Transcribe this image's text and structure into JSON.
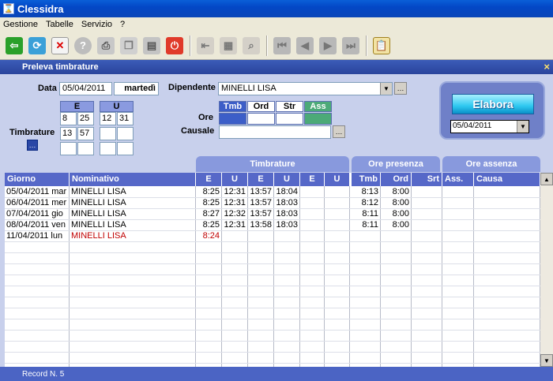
{
  "window": {
    "title": "Clessidra"
  },
  "menu": [
    "Gestione",
    "Tabelle",
    "Servizio",
    "?"
  ],
  "toolbar": {
    "buttons": [
      "exit",
      "refresh",
      "delete",
      "help",
      "print",
      "copy",
      "save",
      "power",
      "first-disabled",
      "calc",
      "zoom",
      "nav-first",
      "nav-prev",
      "nav-next",
      "nav-last",
      "clipboard"
    ]
  },
  "panel": {
    "title": "Preleva timbrature",
    "close": "×",
    "data_label": "Data",
    "data_value": "05/04/2011",
    "weekday": "martedì",
    "dipendente_label": "Dipendente",
    "dipendente_value": "MINELLI LISA",
    "timbrature_label": "Timbrature",
    "e_header": "E",
    "u_header": "U",
    "e_cells": [
      [
        "8",
        "25"
      ],
      [
        "13",
        "57"
      ],
      [
        "",
        ""
      ]
    ],
    "u_cells": [
      [
        "12",
        "31"
      ],
      [
        "",
        ""
      ],
      [
        "",
        ""
      ]
    ],
    "ore_label": "Ore",
    "ore_headers": [
      "Tmb",
      "Ord",
      "Str",
      "Ass"
    ],
    "causale_label": "Causale",
    "causale_value": "",
    "elabora_label": "Elabora",
    "elabora_date": "05/04/2011"
  },
  "grid": {
    "groups": {
      "timbrature": "Timbrature",
      "presenza": "Ore presenza",
      "assenza": "Ore assenza"
    },
    "columns": [
      "Giorno",
      "Nominativo",
      "E",
      "U",
      "E",
      "U",
      "E",
      "U",
      "Tmb",
      "Ord",
      "Srt",
      "Ass.",
      "Causa"
    ],
    "rows": [
      {
        "giorno": "05/04/2011",
        "dow": "mar",
        "nome": "MINELLI LISA",
        "e1": "8:25",
        "u1": "12:31",
        "e2": "13:57",
        "u2": "18:04",
        "tmb": "8:13",
        "ord": "8:00",
        "highlight": false
      },
      {
        "giorno": "06/04/2011",
        "dow": "mer",
        "nome": "MINELLI LISA",
        "e1": "8:25",
        "u1": "12:31",
        "e2": "13:57",
        "u2": "18:03",
        "tmb": "8:12",
        "ord": "8:00",
        "highlight": false
      },
      {
        "giorno": "07/04/2011",
        "dow": "gio",
        "nome": "MINELLI LISA",
        "e1": "8:27",
        "u1": "12:32",
        "e2": "13:57",
        "u2": "18:03",
        "tmb": "8:11",
        "ord": "8:00",
        "highlight": false
      },
      {
        "giorno": "08/04/2011",
        "dow": "ven",
        "nome": "MINELLI LISA",
        "e1": "8:25",
        "u1": "12:31",
        "e2": "13:58",
        "u2": "18:03",
        "tmb": "8:11",
        "ord": "8:00",
        "highlight": false
      },
      {
        "giorno": "11/04/2011",
        "dow": "lun",
        "nome": "MINELLI LISA",
        "e1": "8:24",
        "u1": "",
        "e2": "",
        "u2": "",
        "tmb": "",
        "ord": "",
        "highlight": true
      }
    ],
    "highlight_color": "#c00000"
  },
  "status": {
    "record": "Record N. 5"
  }
}
